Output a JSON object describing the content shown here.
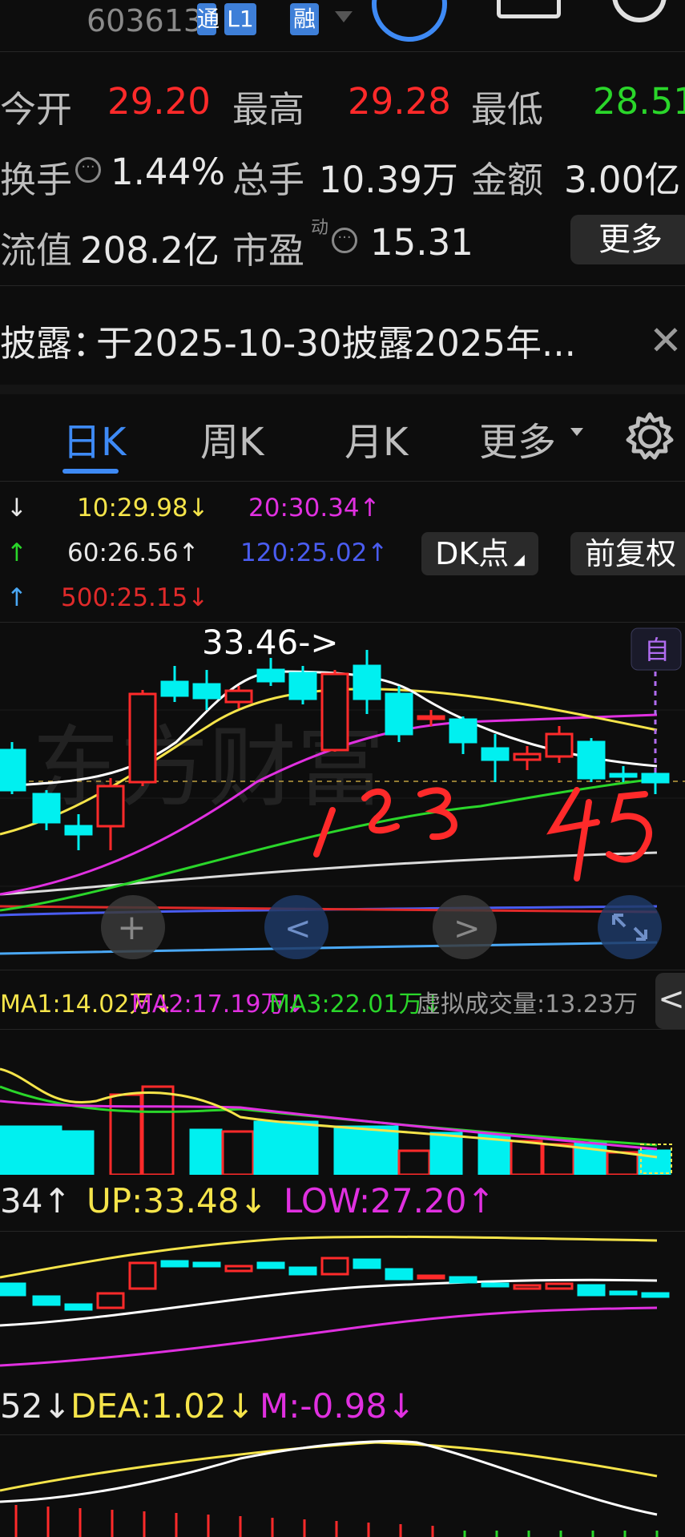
{
  "header": {
    "code": "603613",
    "tag_tong": "通",
    "tag_l1": "L1",
    "tag_rong": "融"
  },
  "quote": {
    "open_label": "今开",
    "open_value": "29.20",
    "high_label": "最高",
    "high_value": "29.28",
    "low_label": "最低",
    "low_value": "28.51",
    "turnover_label": "换手",
    "turnover_value": "1.44%",
    "volume_label": "总手",
    "volume_value": "10.39万",
    "amount_label": "金额",
    "amount_value": "3.00亿",
    "float_label": "流值",
    "float_value": "208.2亿",
    "pe_label": "市盈",
    "pe_sup": "动",
    "pe_value": "15.31",
    "more_label": "更多"
  },
  "notice": {
    "label": "披露：",
    "text": "于2025-10-30披露2025年..."
  },
  "tabs": [
    {
      "label": "日K",
      "active": true
    },
    {
      "label": "周K",
      "active": false
    },
    {
      "label": "月K",
      "active": false
    },
    {
      "label": "更多",
      "active": false
    }
  ],
  "ma_lines": {
    "ma10": "10:29.98↓",
    "ma20": "20:30.34↑",
    "ma60": "60:26.56↑",
    "ma120": "120:25.02↑",
    "ma500": "500:25.15↓",
    "arrow1": "↓",
    "arrow2": "↑",
    "arrow3": "↑",
    "dk_label": "DK点",
    "fq_label": "前复权"
  },
  "chart": {
    "peak_label": "33.46->",
    "self_label": "自",
    "handwriting": "1 2 3  4 5"
  },
  "volume": {
    "ma1": "MA1:14.02万↓",
    "ma2": "MA2:17.19万↓",
    "ma3": "MA3:22.01万↓",
    "virtual": "虚拟成交量:13.23万"
  },
  "boll": {
    "mid": "34↑",
    "up": "UP:33.48↓",
    "low": "LOW:27.20↑"
  },
  "macd": {
    "dif": "52↓",
    "dea": "DEA:1.02↓",
    "m": "M:-0.98↓"
  },
  "colors": {
    "up": "#ff2a2a",
    "down": "#00f0f0",
    "green": "#2ad62a",
    "yellow": "#f5e44a",
    "magenta": "#e030e0",
    "blue": "#3e8af5"
  }
}
